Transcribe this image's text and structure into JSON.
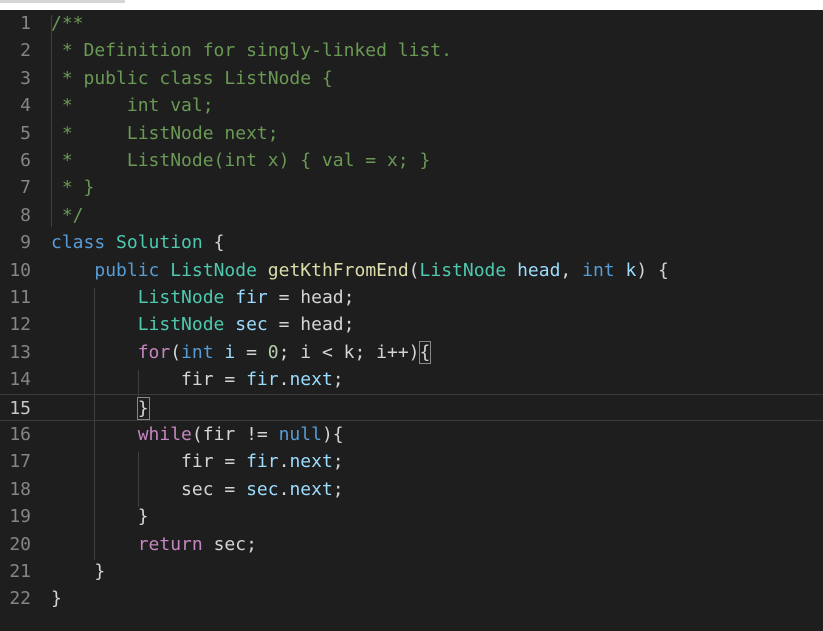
{
  "lines": [
    {
      "n": "1",
      "tokens": [
        [
          "c",
          "/**"
        ]
      ]
    },
    {
      "n": "2",
      "tokens": [
        [
          "c",
          " * Definition for singly-linked list."
        ]
      ]
    },
    {
      "n": "3",
      "tokens": [
        [
          "c",
          " * public class ListNode {"
        ]
      ]
    },
    {
      "n": "4",
      "tokens": [
        [
          "c",
          " *     int val;"
        ]
      ]
    },
    {
      "n": "5",
      "tokens": [
        [
          "c",
          " *     ListNode next;"
        ]
      ]
    },
    {
      "n": "6",
      "tokens": [
        [
          "c",
          " *     ListNode(int x) { val = x; }"
        ]
      ]
    },
    {
      "n": "7",
      "tokens": [
        [
          "c",
          " * }"
        ]
      ]
    },
    {
      "n": "8",
      "tokens": [
        [
          "c",
          " */"
        ]
      ]
    },
    {
      "n": "9",
      "tokens": [
        [
          "k",
          "class"
        ],
        [
          "o",
          " "
        ],
        [
          "t",
          "Solution"
        ],
        [
          "o",
          " {"
        ]
      ]
    },
    {
      "n": "10",
      "tokens": [
        [
          "o",
          "    "
        ],
        [
          "k",
          "public"
        ],
        [
          "o",
          " "
        ],
        [
          "t",
          "ListNode"
        ],
        [
          "o",
          " "
        ],
        [
          "f",
          "getKthFromEnd"
        ],
        [
          "o",
          "("
        ],
        [
          "t",
          "ListNode"
        ],
        [
          "o",
          " "
        ],
        [
          "v",
          "head"
        ],
        [
          "o",
          ", "
        ],
        [
          "k",
          "int"
        ],
        [
          "o",
          " "
        ],
        [
          "v",
          "k"
        ],
        [
          "o",
          ") {"
        ]
      ]
    },
    {
      "n": "11",
      "tokens": [
        [
          "o",
          "        "
        ],
        [
          "t",
          "ListNode"
        ],
        [
          "o",
          " "
        ],
        [
          "v",
          "fir"
        ],
        [
          "o",
          " = head;"
        ]
      ]
    },
    {
      "n": "12",
      "tokens": [
        [
          "o",
          "        "
        ],
        [
          "t",
          "ListNode"
        ],
        [
          "o",
          " "
        ],
        [
          "v",
          "sec"
        ],
        [
          "o",
          " = head;"
        ]
      ]
    },
    {
      "n": "13",
      "tokens": [
        [
          "o",
          "        "
        ],
        [
          "kw",
          "for"
        ],
        [
          "o",
          "("
        ],
        [
          "k",
          "int"
        ],
        [
          "o",
          " "
        ],
        [
          "v",
          "i"
        ],
        [
          "o",
          " = "
        ],
        [
          "n",
          "0"
        ],
        [
          "o",
          "; i < k; i++)"
        ],
        [
          "br",
          "{"
        ]
      ]
    },
    {
      "n": "14",
      "tokens": [
        [
          "o",
          "            fir = "
        ],
        [
          "v",
          "fir"
        ],
        [
          "o",
          "."
        ],
        [
          "v",
          "next"
        ],
        [
          "o",
          ";"
        ]
      ]
    },
    {
      "n": "15",
      "tokens": [
        [
          "o",
          "        "
        ],
        [
          "br",
          "}"
        ]
      ],
      "active": true
    },
    {
      "n": "16",
      "tokens": [
        [
          "o",
          "        "
        ],
        [
          "kw",
          "while"
        ],
        [
          "o",
          "(fir != "
        ],
        [
          "k",
          "null"
        ],
        [
          "o",
          "){"
        ]
      ]
    },
    {
      "n": "17",
      "tokens": [
        [
          "o",
          "            fir = "
        ],
        [
          "v",
          "fir"
        ],
        [
          "o",
          "."
        ],
        [
          "v",
          "next"
        ],
        [
          "o",
          ";"
        ]
      ]
    },
    {
      "n": "18",
      "tokens": [
        [
          "o",
          "            sec = "
        ],
        [
          "v",
          "sec"
        ],
        [
          "o",
          "."
        ],
        [
          "v",
          "next"
        ],
        [
          "o",
          ";"
        ]
      ]
    },
    {
      "n": "19",
      "tokens": [
        [
          "o",
          "        }"
        ]
      ]
    },
    {
      "n": "20",
      "tokens": [
        [
          "o",
          "        "
        ],
        [
          "kw",
          "return"
        ],
        [
          "o",
          " sec;"
        ]
      ]
    },
    {
      "n": "21",
      "tokens": [
        [
          "o",
          "    }"
        ]
      ]
    },
    {
      "n": "22",
      "tokens": [
        [
          "o",
          "}"
        ]
      ]
    }
  ],
  "colors": {
    "background": "#1e1e1e",
    "comment": "#6a9955",
    "keyword": "#569cd6",
    "type": "#4ec9b0",
    "function": "#dcdcaa",
    "variable": "#9cdcfe",
    "control": "#c586c0",
    "number": "#b5cea8",
    "line_number": "#858585"
  }
}
